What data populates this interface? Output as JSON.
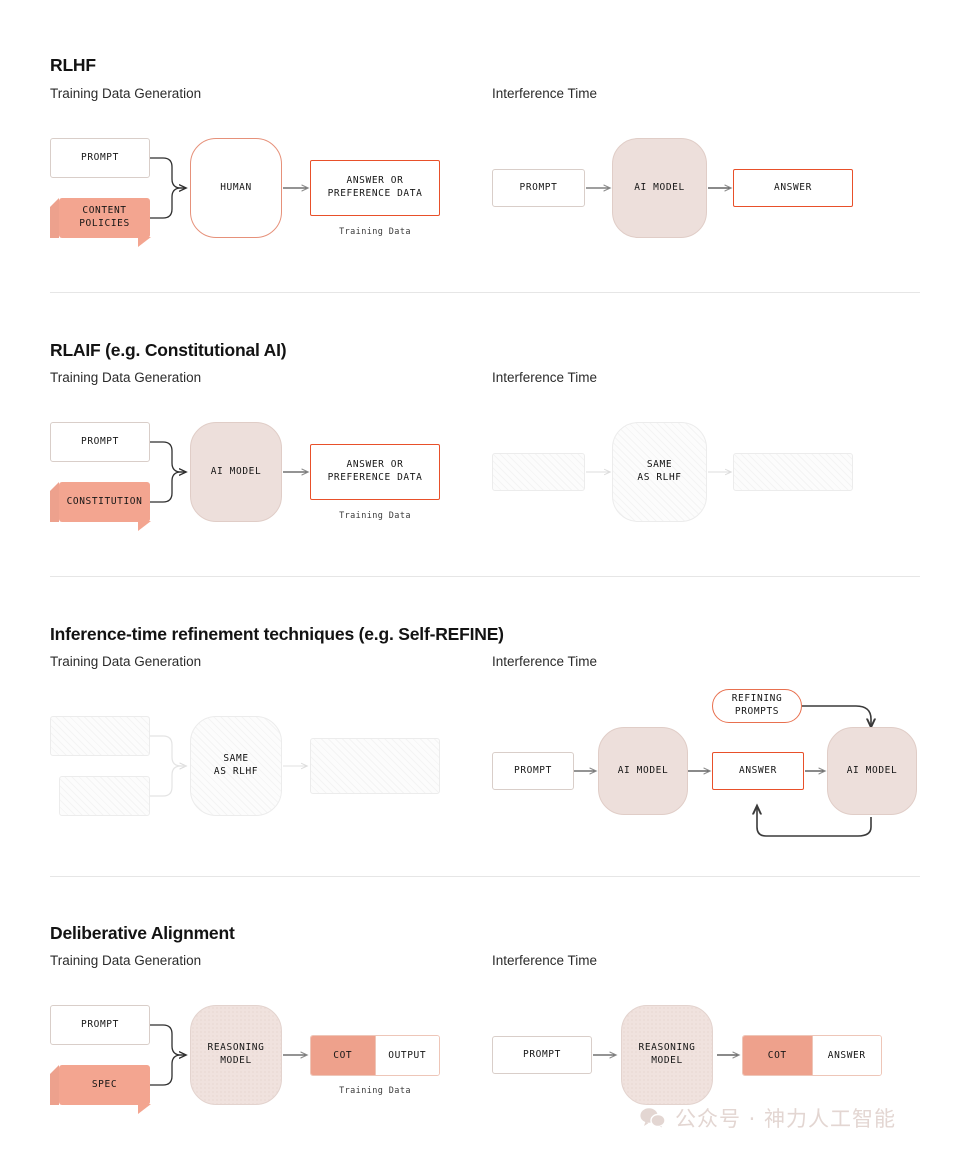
{
  "meta": {
    "colors": {
      "salmon": "#F3A590",
      "model_pink": "#EDDFDB",
      "accent_red": "#E8502A",
      "outline_orange": "#E6917A",
      "warm_border": "#D9CEC9",
      "divider": "#E6E6E6",
      "watermark": "#E3D6D2"
    }
  },
  "column_labels": {
    "training": "Training Data Generation",
    "inference": "Interference Time"
  },
  "sections": [
    {
      "id": "rlhf",
      "title": "RLHF",
      "training": {
        "prompt": "PROMPT",
        "policy": "CONTENT\nPOLICIES",
        "processor": "HUMAN",
        "output": "ANSWER OR\nPREFERENCE DATA",
        "caption": "Training Data"
      },
      "inference": {
        "prompt": "PROMPT",
        "model": "AI MODEL",
        "answer": "ANSWER"
      }
    },
    {
      "id": "rlaif",
      "title": "RLAIF (e.g. Constitutional AI)",
      "training": {
        "prompt": "PROMPT",
        "policy": "CONSTITUTION",
        "processor": "AI MODEL",
        "output": "ANSWER OR\nPREFERENCE DATA",
        "caption": "Training Data"
      },
      "inference": {
        "prompt": "",
        "model": "SAME\nAS RLHF",
        "answer": ""
      }
    },
    {
      "id": "self-refine",
      "title": "Inference-time refinement techniques (e.g. Self-REFINE)",
      "training": {
        "prompt": "",
        "policy": "",
        "processor": "SAME\nAS RLHF",
        "output": "",
        "caption": ""
      },
      "inference": {
        "prompt": "PROMPT",
        "model": "AI MODEL",
        "answer": "ANSWER",
        "refining_prompts": "REFINING\nPROMPTS",
        "model2": "AI MODEL"
      }
    },
    {
      "id": "deliberative-alignment",
      "title": "Deliberative Alignment",
      "training": {
        "prompt": "PROMPT",
        "policy": "SPEC",
        "processor": "REASONING\nMODEL",
        "output_cot": "COT",
        "output_tail": "OUTPUT",
        "caption": "Training Data"
      },
      "inference": {
        "prompt": "PROMPT",
        "model": "REASONING\nMODEL",
        "output_cot": "COT",
        "output_tail": "ANSWER"
      }
    }
  ],
  "watermark": {
    "icon": "wechat-icon",
    "text": "公众号 · 神力人工智能"
  }
}
